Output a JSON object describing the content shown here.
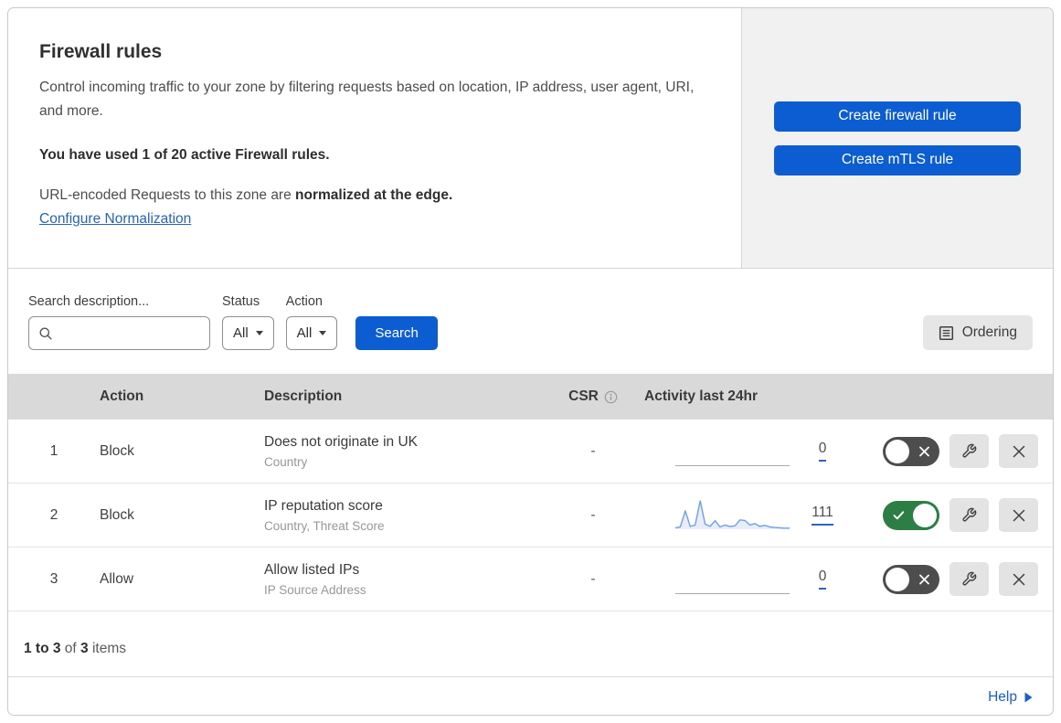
{
  "page": {
    "title": "Firewall rules",
    "description": "Control incoming traffic to your zone by filtering requests based on location, IP address, user agent, URI, and more.",
    "usage_notice": "You have used 1 of 20 active Firewall rules.",
    "normalization_text": "URL-encoded Requests to this zone are ",
    "normalization_bold": "normalized at the edge.",
    "normalization_link": "Configure Normalization"
  },
  "actions": {
    "create_firewall_rule": "Create firewall rule",
    "create_mtls_rule": "Create mTLS rule"
  },
  "filters": {
    "search_label": "Search description...",
    "status_label": "Status",
    "status_value": "All",
    "action_label": "Action",
    "action_value": "All",
    "search_button": "Search",
    "ordering_button": "Ordering"
  },
  "table": {
    "headers": {
      "action": "Action",
      "description": "Description",
      "csr": "CSR",
      "activity": "Activity last 24hr"
    },
    "rows": [
      {
        "priority": "1",
        "action": "Block",
        "description": "Does not originate in UK",
        "match_fields": "Country",
        "csr": "-",
        "activity_count": "0",
        "enabled": false
      },
      {
        "priority": "2",
        "action": "Block",
        "description": "IP reputation score",
        "match_fields": "Country, Threat Score",
        "csr": "-",
        "activity_count": "111",
        "enabled": true
      },
      {
        "priority": "3",
        "action": "Allow",
        "description": "Allow listed IPs",
        "match_fields": "IP Source Address",
        "csr": "-",
        "activity_count": "0",
        "enabled": false
      }
    ]
  },
  "chart_data": {
    "type": "area",
    "title": "Activity last 24hr sparkline (rule 2)",
    "values": [
      5,
      8,
      65,
      10,
      15,
      100,
      18,
      10,
      30,
      8,
      15,
      10,
      12,
      33,
      31,
      15,
      20,
      10,
      14,
      8,
      6,
      5,
      4,
      4
    ],
    "ylim": [
      0,
      100
    ]
  },
  "footer": {
    "range": "1 to 3",
    "of": " of ",
    "total": "3",
    "items": " items",
    "help": "Help"
  },
  "icons": {
    "search": "magnifier",
    "dropdown": "caret-down",
    "ordering": "list-document",
    "csr_info": "info-circle",
    "toggle_off": "x-mark",
    "toggle_on": "check-mark",
    "configure": "wrench",
    "delete": "x-mark",
    "help": "right-triangle"
  },
  "colors": {
    "primary_button": "#0d5dd2",
    "link": "#2563bc",
    "toggle_on": "#2c7e44",
    "toggle_off": "#4d4d4d",
    "sparkline_stroke": "#6f9fe8",
    "sparkline_fill": "#e7eefa",
    "table_header_bg": "#d9d9d9",
    "side_panel_bg": "#f1f1f1"
  }
}
